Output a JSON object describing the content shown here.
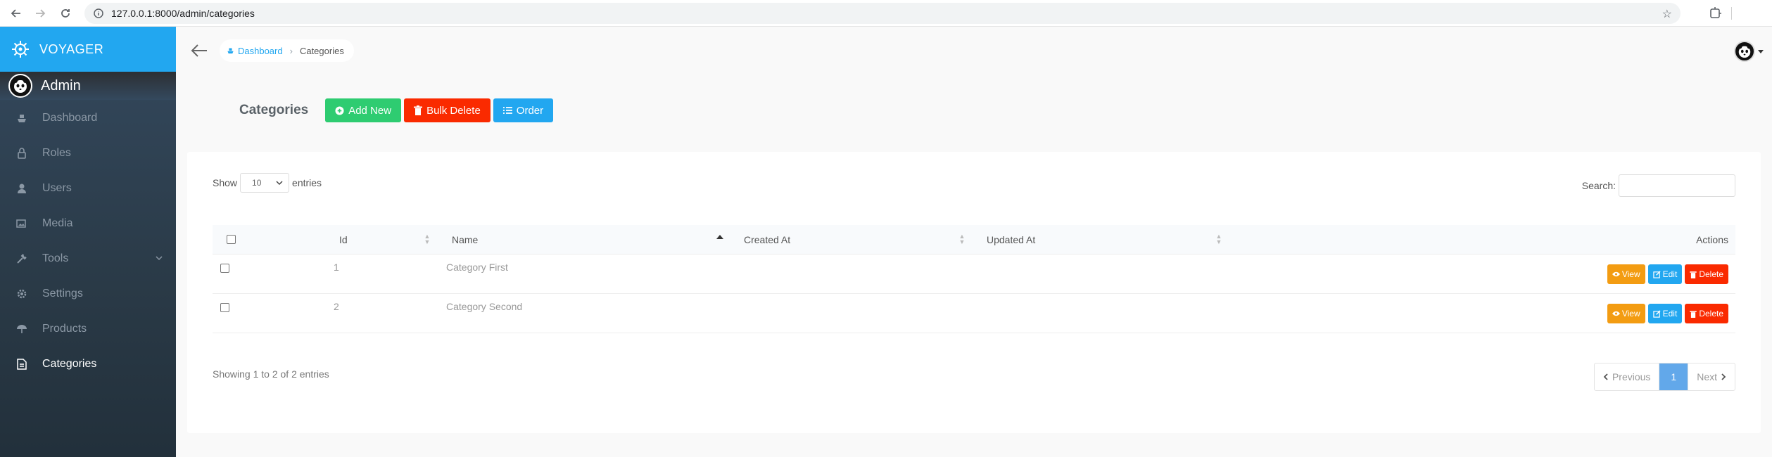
{
  "browser": {
    "url": "127.0.0.1:8000/admin/categories"
  },
  "brand": {
    "name": "VOYAGER",
    "color": "#22a7f0"
  },
  "profile": {
    "name": "Admin"
  },
  "sidebar": {
    "items": [
      {
        "label": "Dashboard",
        "icon": "boat-icon"
      },
      {
        "label": "Roles",
        "icon": "lock-icon"
      },
      {
        "label": "Users",
        "icon": "person-icon"
      },
      {
        "label": "Media",
        "icon": "images-icon"
      },
      {
        "label": "Tools",
        "icon": "tools-icon"
      },
      {
        "label": "Settings",
        "icon": "gear-icon"
      },
      {
        "label": "Products",
        "icon": "umbrella-icon"
      },
      {
        "label": "Categories",
        "icon": "document-icon",
        "active": true
      }
    ]
  },
  "breadcrumb": {
    "home": "Dashboard",
    "current": "Categories"
  },
  "page": {
    "title": "Categories",
    "add_new": "Add New",
    "bulk_delete": "Bulk Delete",
    "order": "Order"
  },
  "table_controls": {
    "show": "Show",
    "entries": "entries",
    "length_value": "10",
    "search_label": "Search:"
  },
  "table": {
    "columns": [
      "Id",
      "Name",
      "Created At",
      "Updated At",
      "Actions"
    ],
    "rows": [
      {
        "id": "1",
        "name": "Category First",
        "created_at": "",
        "updated_at": ""
      },
      {
        "id": "2",
        "name": "Category Second",
        "created_at": "",
        "updated_at": ""
      }
    ],
    "actions": {
      "view": "View",
      "edit": "Edit",
      "delete": "Delete"
    }
  },
  "footer": {
    "info": "Showing 1 to 2 of 2 entries",
    "previous": "Previous",
    "page": "1",
    "next": "Next"
  },
  "colors": {
    "success": "#2ecc71",
    "danger": "#fa2a00",
    "primary": "#22a7f0",
    "warning": "#f39c12"
  }
}
